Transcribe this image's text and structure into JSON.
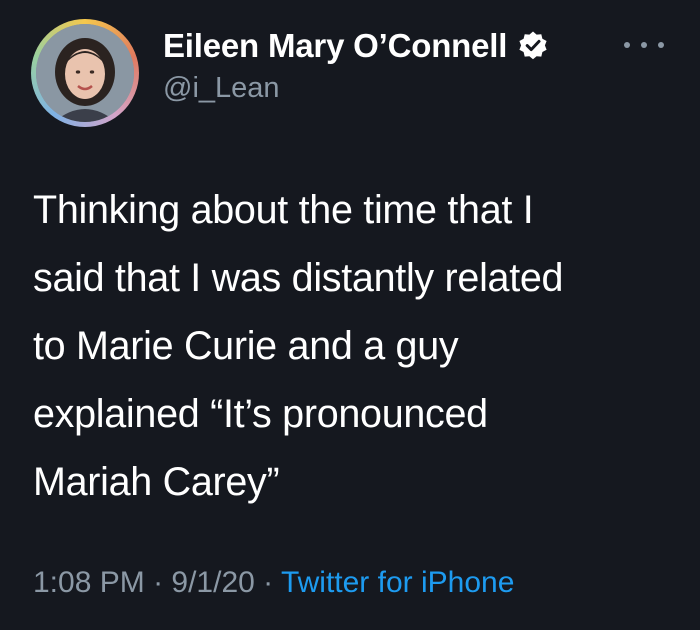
{
  "author": {
    "display_name": "Eileen Mary O’Connell",
    "handle": "@i_Lean",
    "verified": true,
    "avatar_icon": "profile-photo",
    "verified_icon": "verified-badge-icon"
  },
  "more_icon": "more-options-icon",
  "tweet": {
    "lines": [
      "Thinking about the time that I",
      "said that I was distantly related",
      "to Marie Curie and a guy",
      "explained “It’s pronounced",
      "Mariah Carey”"
    ]
  },
  "meta": {
    "time": "1:08 PM",
    "separator": " · ",
    "date": "9/1/20",
    "source": "Twitter for iPhone"
  },
  "colors": {
    "background": "#15181f",
    "text": "#ffffff",
    "secondary": "#8b98a5",
    "link": "#1d9bf0"
  }
}
